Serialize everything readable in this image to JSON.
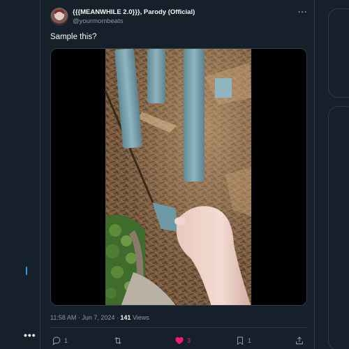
{
  "nav": {
    "more_label": "•••"
  },
  "tweet": {
    "display_name": "{{{MEANWHILE 2.0}}}, Parody (Official)",
    "handle": "@yourmombeats",
    "text": "Sample this?",
    "more_label": "···",
    "time": "11:58 AM",
    "separator": " · ",
    "date": "Jun 7, 2024",
    "views_count": "141",
    "views_label": " Views",
    "replies": "1",
    "retweets": "",
    "likes": "3",
    "bookmarks": "1",
    "liked": true
  },
  "colors": {
    "background": "#15202b",
    "accent": "#1d9bf0",
    "like": "#f91880",
    "muted": "#8b98a5"
  },
  "icons": [
    "reply-icon",
    "retweet-icon",
    "heart-icon",
    "bookmark-icon",
    "share-icon",
    "more-icon"
  ]
}
